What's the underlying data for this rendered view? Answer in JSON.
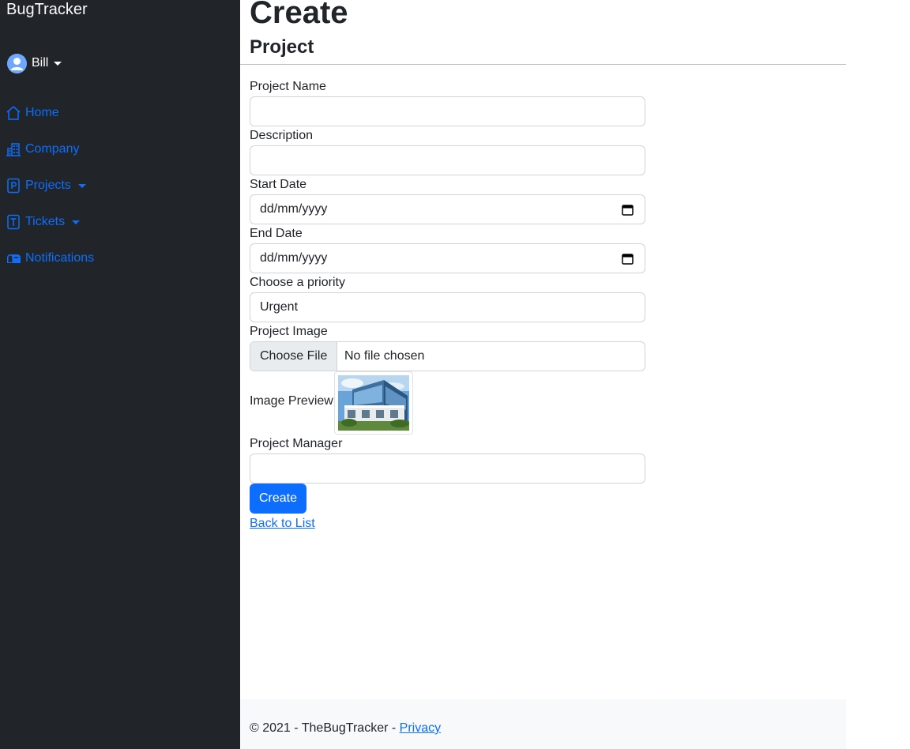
{
  "app": {
    "brand": "BugTracker"
  },
  "user": {
    "name": "Bill"
  },
  "nav": {
    "home": "Home",
    "company": "Company",
    "projects": "Projects",
    "tickets": "Tickets",
    "notifications": "Notifications"
  },
  "page": {
    "title": "Create",
    "subtitle": "Project"
  },
  "form": {
    "project_name_label": "Project Name",
    "project_name_value": "",
    "description_label": "Description",
    "description_value": "",
    "start_date_label": "Start Date",
    "start_date_value": "dd/mm/yyyy",
    "end_date_label": "End Date",
    "end_date_value": "dd/mm/yyyy",
    "priority_label": "Choose a priority",
    "priority_value": "Urgent",
    "image_label": "Project Image",
    "choose_file_label": "Choose File",
    "file_status": "No file chosen",
    "preview_label": "Image Preview",
    "manager_label": "Project Manager",
    "manager_value": "",
    "create_label": "Create",
    "back_label": "Back to List"
  },
  "footer": {
    "text": "© 2021 - TheBugTracker - ",
    "privacy": "Privacy"
  },
  "colors": {
    "sidebar": "#212529",
    "link": "#0d6efd",
    "primary": "#0d6efd",
    "footer_bg": "#f8f9fa"
  }
}
